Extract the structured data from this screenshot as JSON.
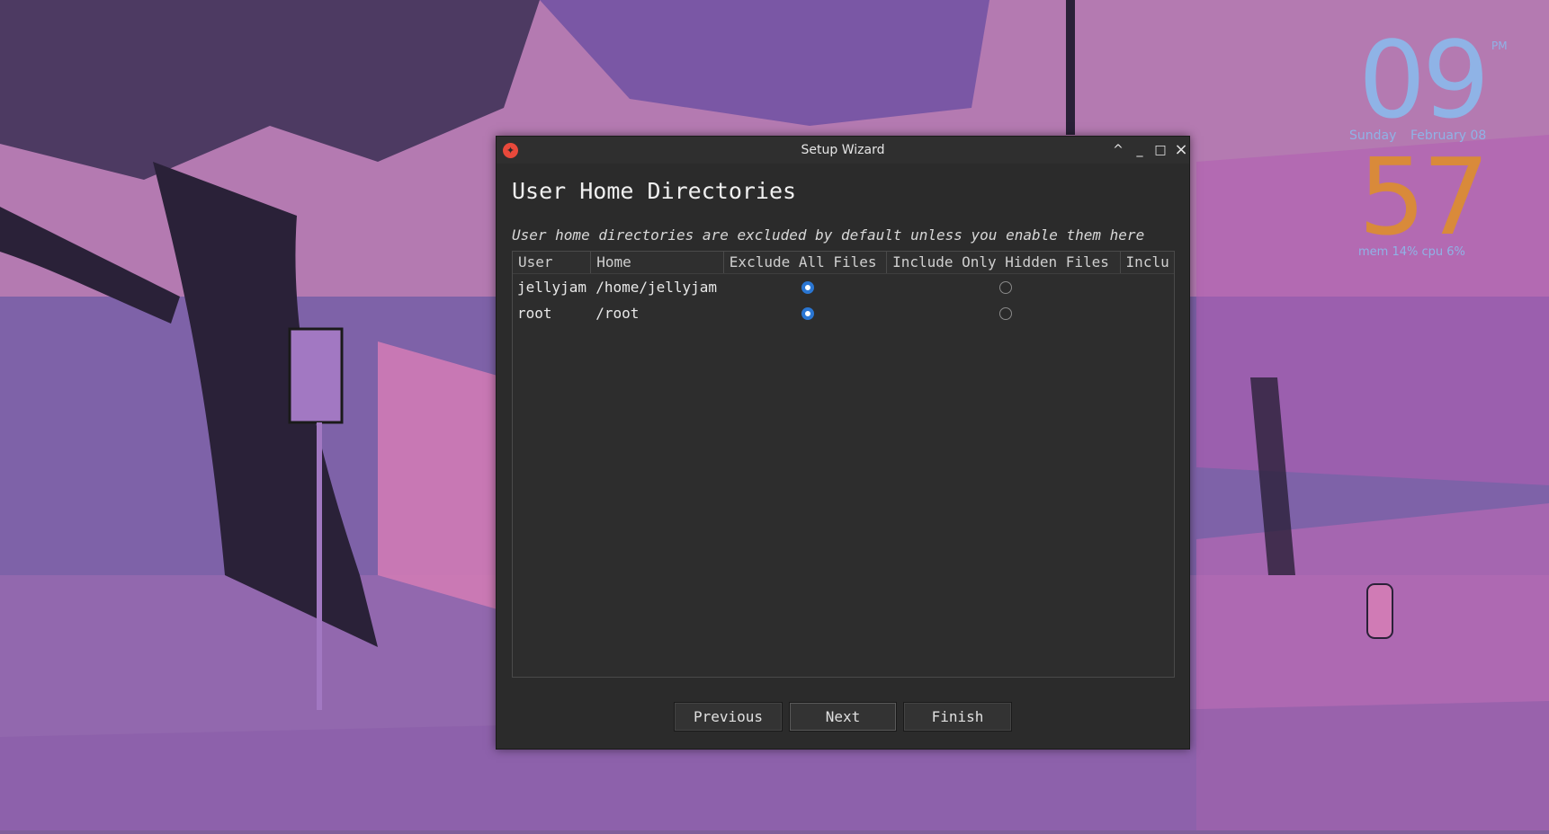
{
  "desktop": {
    "clock": {
      "hour": "09",
      "minute": "57",
      "ampm": "PM",
      "day": "Sunday",
      "date": "February 08",
      "stats": "mem 14%  cpu  6%"
    },
    "colors": {
      "hour": "#8fb3e6",
      "minute": "#d98a3a"
    }
  },
  "window": {
    "title": "Setup Wizard",
    "app_icon": "app-logo-icon",
    "controls": {
      "shade": "^",
      "minimize": "_",
      "maximize": "□",
      "close": "×"
    }
  },
  "page": {
    "title": "User Home Directories",
    "description": "User home directories are excluded by default unless you enable them here"
  },
  "table": {
    "columns": [
      "User",
      "Home",
      "Exclude All Files",
      "Include Only Hidden Files",
      "Inclu"
    ],
    "rows": [
      {
        "user": "jellyjam",
        "home": "/home/jellyjam",
        "selected": "exclude_all"
      },
      {
        "user": "root",
        "home": "/root",
        "selected": "exclude_all"
      }
    ]
  },
  "buttons": {
    "previous": "Previous",
    "next": "Next",
    "finish": "Finish"
  },
  "accent_color": "#2a76d2"
}
